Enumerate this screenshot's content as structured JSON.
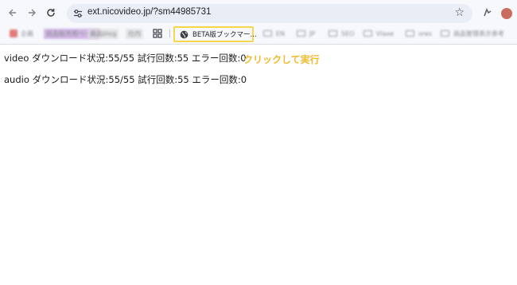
{
  "browser": {
    "url": "ext.nicovideo.jp/?sm44985731",
    "bookmarks": [
      {
        "label": "企画",
        "type": "favicon",
        "color": "#d9534f"
      },
      {
        "label": "商品販売用ページ",
        "type": "favicon",
        "color": "#9b59b6"
      },
      {
        "label": "商品blog",
        "type": "favicon",
        "color": "#b0b0b0"
      },
      {
        "label": "社内",
        "type": "favicon",
        "color": "#b0b0b0"
      },
      {
        "label": "EN",
        "type": "folder"
      },
      {
        "label": "JP",
        "type": "folder"
      },
      {
        "label": "SEO",
        "type": "folder"
      },
      {
        "label": "Vlaxe",
        "type": "folder"
      },
      {
        "label": "ores",
        "type": "folder"
      },
      {
        "label": "商品管理表示参考",
        "type": "folder"
      }
    ],
    "highlighted_bookmark": "BETA版ブックマー..."
  },
  "page": {
    "lines": [
      "video ダウンロード状況:55/55 試行回数:55 エラー回数:0",
      "audio ダウンロード状況:55/55 試行回数:55 エラー回数:0"
    ],
    "annotation": "クリックして実行"
  },
  "colors": {
    "highlight": "#f6d64a",
    "annotation": "#f0b92c"
  }
}
